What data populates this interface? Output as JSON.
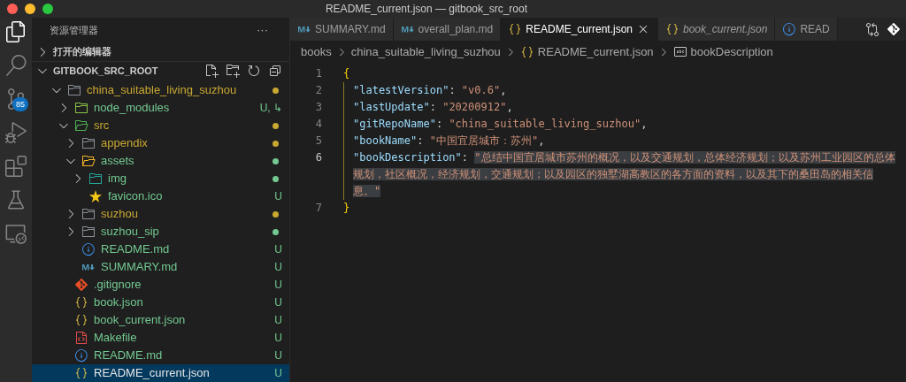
{
  "window": {
    "title": "README_current.json — gitbook_src_root"
  },
  "activity_bar": [
    {
      "kind": "files",
      "selected": true
    },
    {
      "kind": "search",
      "selected": false
    },
    {
      "kind": "source-control",
      "selected": false,
      "badge": "85"
    },
    {
      "kind": "debug",
      "selected": false
    },
    {
      "kind": "extensions",
      "selected": false
    },
    {
      "kind": "beaker",
      "selected": false
    },
    {
      "kind": "remote",
      "selected": false
    }
  ],
  "sidebar": {
    "title": "资源管理器",
    "more": "···",
    "sections": [
      {
        "label": "打开的编辑器",
        "expanded": false
      },
      {
        "label": "GITBOOK_SRC_ROOT",
        "expanded": true
      }
    ],
    "tree": [
      {
        "name": "china_suitable_living_suzhou",
        "kind": "folder",
        "color": "#c9a832",
        "expanded": true,
        "selected": false,
        "children": [
          {
            "name": "node_modules",
            "kind": "folder-node",
            "color": "#73c991",
            "badge": "U, ↳",
            "expanded": false,
            "selected": false
          },
          {
            "name": "src",
            "kind": "folder-src",
            "color": "#c9a832",
            "expanded": true,
            "selected": false,
            "children": [
              {
                "name": "appendix",
                "kind": "folder",
                "color": "#c9a832",
                "expanded": false,
                "selected": false
              },
              {
                "name": "assets",
                "kind": "folder-assets",
                "color": "#73c991",
                "expanded": true,
                "selected": false,
                "children": [
                  {
                    "name": "img",
                    "kind": "folder-img",
                    "color": "#73c991",
                    "expanded": false,
                    "selected": false
                  },
                  {
                    "name": "favicon.ico",
                    "kind": "star",
                    "color": "#73c991",
                    "badge": "U",
                    "selected": false
                  }
                ]
              },
              {
                "name": "suzhou",
                "kind": "folder",
                "color": "#c9a832",
                "expanded": false,
                "selected": false
              },
              {
                "name": "suzhou_sip",
                "kind": "folder",
                "color": "#73c991",
                "expanded": false,
                "selected": false
              },
              {
                "name": "README.md",
                "kind": "info",
                "color": "#73c991",
                "badge": "U",
                "selected": false
              },
              {
                "name": "SUMMARY.md",
                "kind": "markdown",
                "color": "#73c991",
                "badge": "U",
                "selected": false
              }
            ]
          },
          {
            "name": ".gitignore",
            "kind": "git",
            "color": "#73c991",
            "badge": "U",
            "selected": false
          },
          {
            "name": "book.json",
            "kind": "json",
            "color": "#73c991",
            "badge": "U",
            "selected": false
          },
          {
            "name": "book_current.json",
            "kind": "json",
            "color": "#73c991",
            "badge": "U",
            "selected": false
          },
          {
            "name": "Makefile",
            "kind": "makefile",
            "color": "#73c991",
            "badge": "U",
            "selected": false
          },
          {
            "name": "README.md",
            "kind": "info",
            "color": "#73c991",
            "badge": "U",
            "selected": false
          },
          {
            "name": "README_current.json",
            "kind": "json",
            "color": "#73c991",
            "badge": "U",
            "selected": true
          }
        ]
      }
    ]
  },
  "tabs": [
    {
      "label": "SUMMARY.md",
      "kind": "markdown",
      "selected": false,
      "preview": false
    },
    {
      "label": "overall_plan.md",
      "kind": "markdown",
      "selected": false,
      "preview": false
    },
    {
      "label": "README_current.json",
      "kind": "json",
      "selected": true,
      "preview": false
    },
    {
      "label": "book_current.json",
      "kind": "json",
      "selected": false,
      "preview": true
    },
    {
      "label": "READ",
      "kind": "info",
      "selected": false,
      "preview": false
    }
  ],
  "breadcrumb": [
    {
      "label": "books",
      "kind": "folder"
    },
    {
      "label": "china_suitable_living_suzhou",
      "kind": "folder"
    },
    {
      "label": "README_current.json",
      "kind": "json"
    },
    {
      "label": "bookDescription",
      "kind": "string"
    }
  ],
  "editor": {
    "lines": [
      {
        "number": "1",
        "current": false,
        "indented": false,
        "tokens": [
          {
            "kind": "brace",
            "text": "{",
            "selected": false
          }
        ]
      },
      {
        "number": "2",
        "current": false,
        "indented": true,
        "tokens": [
          {
            "kind": "key",
            "text": "\"latestVersion\"",
            "selected": false
          },
          {
            "kind": "punct",
            "text": ": ",
            "selected": false
          },
          {
            "kind": "string",
            "text": "\"v0.6\"",
            "selected": false
          },
          {
            "kind": "punct",
            "text": ",",
            "selected": false
          }
        ]
      },
      {
        "number": "3",
        "current": false,
        "indented": true,
        "tokens": [
          {
            "kind": "key",
            "text": "\"lastUpdate\"",
            "selected": false
          },
          {
            "kind": "punct",
            "text": ": ",
            "selected": false
          },
          {
            "kind": "string",
            "text": "\"20200912\"",
            "selected": false
          },
          {
            "kind": "punct",
            "text": ",",
            "selected": false
          }
        ]
      },
      {
        "number": "4",
        "current": false,
        "indented": true,
        "tokens": [
          {
            "kind": "key",
            "text": "\"gitRepoName\"",
            "selected": false
          },
          {
            "kind": "punct",
            "text": ": ",
            "selected": false
          },
          {
            "kind": "string",
            "text": "\"china_suitable_living_suzhou\"",
            "selected": false
          },
          {
            "kind": "punct",
            "text": ",",
            "selected": false
          }
        ]
      },
      {
        "number": "5",
        "current": false,
        "indented": true,
        "tokens": [
          {
            "kind": "key",
            "text": "\"bookName\"",
            "selected": false
          },
          {
            "kind": "punct",
            "text": ": ",
            "selected": false
          },
          {
            "kind": "string",
            "text": "\"中国宜居城市：苏州\"",
            "selected": false
          },
          {
            "kind": "punct",
            "text": ",",
            "selected": false
          }
        ]
      },
      {
        "number": "6",
        "current": true,
        "indented": true,
        "tokens": [
          {
            "kind": "key",
            "text": "\"bookDescription\"",
            "selected": false
          },
          {
            "kind": "punct",
            "text": ": ",
            "selected": false
          },
          {
            "kind": "string",
            "text": "\"总结中国宜居城市苏州的概况，以及交通规划，总体经济规划；以及苏州工业园区的总体规划，社区概况，经济规划，交通规划；以及园区的独墅湖高教区的各方面的资料，以及其下的桑田岛的相关信息。\"",
            "selected": true
          }
        ]
      },
      {
        "number": "7",
        "current": false,
        "indented": false,
        "tokens": [
          {
            "kind": "brace",
            "text": "}",
            "selected": false
          }
        ]
      }
    ]
  }
}
